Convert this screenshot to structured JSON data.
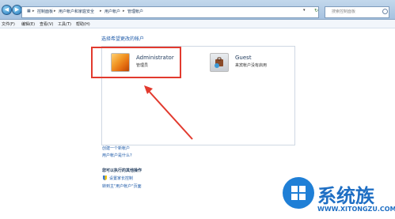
{
  "address_bar": {
    "breadcrumbs": [
      "控制面板",
      "用户帐户和家庭安全",
      "用户帐户",
      "管理帐户"
    ],
    "search_placeholder": "搜索控制面板"
  },
  "menu": [
    "文件(F)",
    "编辑(E)",
    "查看(V)",
    "工具(T)",
    "帮助(H)"
  ],
  "heading": "选择希望更改的帐户",
  "accounts": [
    {
      "name": "Administrator",
      "type": "管理员"
    },
    {
      "name": "Guest",
      "type": "来宾帐户没有启用"
    }
  ],
  "links": {
    "create_account": "创建一个新帐户",
    "what_is_account": "用户帐户是什么?",
    "additional_heading": "您可以执行的其他操作",
    "parental_controls": "设置家长控制",
    "go_to_main": "转到主\"用户帐户\"页面"
  },
  "watermark": {
    "title": "系统族",
    "url": "WWW.XITONGZU.COM"
  },
  "colors": {
    "highlight": "#e23a2e",
    "link": "#1e5aa8",
    "watermark": "#1f6fc4"
  }
}
